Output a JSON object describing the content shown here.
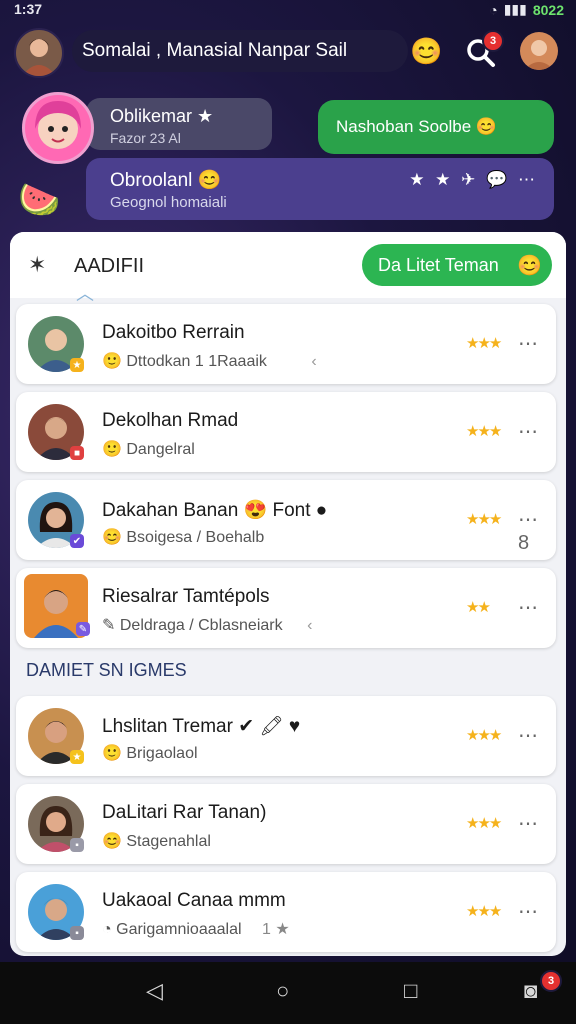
{
  "status": {
    "time": "1:37",
    "battery": "8022"
  },
  "header": {
    "title": "Somalai ,  Manasial   Nanpar Sail",
    "notif_count": "3"
  },
  "group": {
    "user_name": "Oblikemar ★",
    "user_sub": "Fazor 23 Al",
    "green_message": "Nashoban Soolbe 😊",
    "chat_name": "Obroolanl 😊",
    "chat_sub": "Geognol homaiali",
    "tools": "★ ★ ✈ 💬 ⋯"
  },
  "panel": {
    "title": "AADIFII",
    "add_friend": "Da Litet Teman",
    "section_label": "DAMIET SN IGMES",
    "friends": [
      {
        "name": "Dakoitbo Rerrain",
        "sub": "Dttodkan 1 1Raaaik",
        "sub_icon": "🙂",
        "extra": "‹",
        "stars": "★★★",
        "more": "⋯"
      },
      {
        "name": "Dekolhan Rmad",
        "sub": "Dangelral",
        "sub_icon": "🙂",
        "extra": "",
        "stars": "★★★",
        "more": "⋯"
      },
      {
        "name": "Dakahan Banan 😍 Font ●",
        "sub": "Bsoigesa / Boehalb",
        "sub_icon": "😊",
        "extra": "",
        "stars": "★★★",
        "more": "⋯ 8"
      },
      {
        "name": "Riesalrar Tamtépols",
        "sub": "Deldraga / Cblasneiark",
        "sub_icon": "✎",
        "extra": "‹",
        "stars": "★★",
        "more": "⋯"
      }
    ],
    "recent": [
      {
        "name": "Lhslitan Tremar ✔ 🖍 ♥",
        "sub": "Brigaolaol",
        "sub_icon": "🙂",
        "extra": "",
        "stars": "★★★",
        "more": "⋯"
      },
      {
        "name": "DaLitari Rar Tanan)",
        "sub": "Stagenahlal",
        "sub_icon": "😊",
        "extra": "",
        "stars": "★★★",
        "more": "⋯"
      },
      {
        "name": "Uakaoal Canaa  mmm",
        "sub": "Garigamnioaaalal",
        "sub_icon": "◔",
        "extra": "1 ★",
        "stars": "★★★",
        "more": "⋯"
      }
    ]
  },
  "nav": {
    "badge": "3"
  },
  "icons": [
    "signal-icon",
    "search-icon",
    "star-icon",
    "back-icon",
    "more-icon",
    "home-icon",
    "square-icon"
  ],
  "colors": {
    "accent_green": "#2cb552",
    "panel_bg": "#f1f2f6",
    "chat_purple": "#4b3f8e"
  }
}
